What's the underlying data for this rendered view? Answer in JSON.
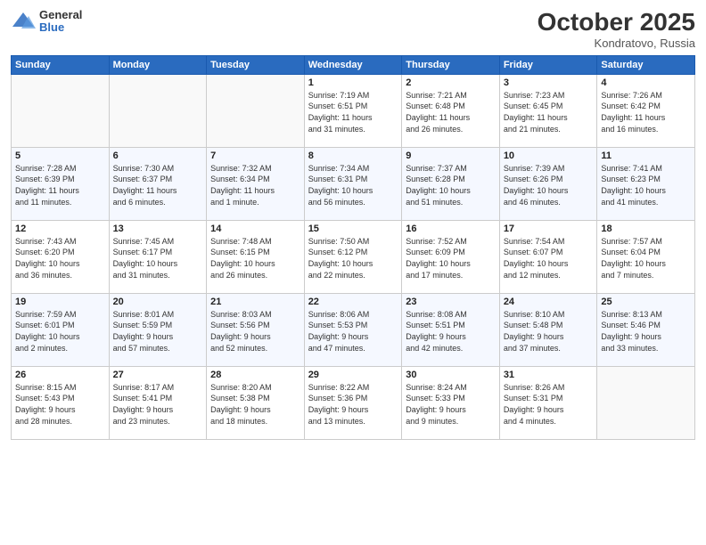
{
  "header": {
    "logo_general": "General",
    "logo_blue": "Blue",
    "month_title": "October 2025",
    "location": "Kondratovo, Russia"
  },
  "days_of_week": [
    "Sunday",
    "Monday",
    "Tuesday",
    "Wednesday",
    "Thursday",
    "Friday",
    "Saturday"
  ],
  "weeks": [
    [
      {
        "day": "",
        "info": ""
      },
      {
        "day": "",
        "info": ""
      },
      {
        "day": "",
        "info": ""
      },
      {
        "day": "1",
        "info": "Sunrise: 7:19 AM\nSunset: 6:51 PM\nDaylight: 11 hours\nand 31 minutes."
      },
      {
        "day": "2",
        "info": "Sunrise: 7:21 AM\nSunset: 6:48 PM\nDaylight: 11 hours\nand 26 minutes."
      },
      {
        "day": "3",
        "info": "Sunrise: 7:23 AM\nSunset: 6:45 PM\nDaylight: 11 hours\nand 21 minutes."
      },
      {
        "day": "4",
        "info": "Sunrise: 7:26 AM\nSunset: 6:42 PM\nDaylight: 11 hours\nand 16 minutes."
      }
    ],
    [
      {
        "day": "5",
        "info": "Sunrise: 7:28 AM\nSunset: 6:39 PM\nDaylight: 11 hours\nand 11 minutes."
      },
      {
        "day": "6",
        "info": "Sunrise: 7:30 AM\nSunset: 6:37 PM\nDaylight: 11 hours\nand 6 minutes."
      },
      {
        "day": "7",
        "info": "Sunrise: 7:32 AM\nSunset: 6:34 PM\nDaylight: 11 hours\nand 1 minute."
      },
      {
        "day": "8",
        "info": "Sunrise: 7:34 AM\nSunset: 6:31 PM\nDaylight: 10 hours\nand 56 minutes."
      },
      {
        "day": "9",
        "info": "Sunrise: 7:37 AM\nSunset: 6:28 PM\nDaylight: 10 hours\nand 51 minutes."
      },
      {
        "day": "10",
        "info": "Sunrise: 7:39 AM\nSunset: 6:26 PM\nDaylight: 10 hours\nand 46 minutes."
      },
      {
        "day": "11",
        "info": "Sunrise: 7:41 AM\nSunset: 6:23 PM\nDaylight: 10 hours\nand 41 minutes."
      }
    ],
    [
      {
        "day": "12",
        "info": "Sunrise: 7:43 AM\nSunset: 6:20 PM\nDaylight: 10 hours\nand 36 minutes."
      },
      {
        "day": "13",
        "info": "Sunrise: 7:45 AM\nSunset: 6:17 PM\nDaylight: 10 hours\nand 31 minutes."
      },
      {
        "day": "14",
        "info": "Sunrise: 7:48 AM\nSunset: 6:15 PM\nDaylight: 10 hours\nand 26 minutes."
      },
      {
        "day": "15",
        "info": "Sunrise: 7:50 AM\nSunset: 6:12 PM\nDaylight: 10 hours\nand 22 minutes."
      },
      {
        "day": "16",
        "info": "Sunrise: 7:52 AM\nSunset: 6:09 PM\nDaylight: 10 hours\nand 17 minutes."
      },
      {
        "day": "17",
        "info": "Sunrise: 7:54 AM\nSunset: 6:07 PM\nDaylight: 10 hours\nand 12 minutes."
      },
      {
        "day": "18",
        "info": "Sunrise: 7:57 AM\nSunset: 6:04 PM\nDaylight: 10 hours\nand 7 minutes."
      }
    ],
    [
      {
        "day": "19",
        "info": "Sunrise: 7:59 AM\nSunset: 6:01 PM\nDaylight: 10 hours\nand 2 minutes."
      },
      {
        "day": "20",
        "info": "Sunrise: 8:01 AM\nSunset: 5:59 PM\nDaylight: 9 hours\nand 57 minutes."
      },
      {
        "day": "21",
        "info": "Sunrise: 8:03 AM\nSunset: 5:56 PM\nDaylight: 9 hours\nand 52 minutes."
      },
      {
        "day": "22",
        "info": "Sunrise: 8:06 AM\nSunset: 5:53 PM\nDaylight: 9 hours\nand 47 minutes."
      },
      {
        "day": "23",
        "info": "Sunrise: 8:08 AM\nSunset: 5:51 PM\nDaylight: 9 hours\nand 42 minutes."
      },
      {
        "day": "24",
        "info": "Sunrise: 8:10 AM\nSunset: 5:48 PM\nDaylight: 9 hours\nand 37 minutes."
      },
      {
        "day": "25",
        "info": "Sunrise: 8:13 AM\nSunset: 5:46 PM\nDaylight: 9 hours\nand 33 minutes."
      }
    ],
    [
      {
        "day": "26",
        "info": "Sunrise: 8:15 AM\nSunset: 5:43 PM\nDaylight: 9 hours\nand 28 minutes."
      },
      {
        "day": "27",
        "info": "Sunrise: 8:17 AM\nSunset: 5:41 PM\nDaylight: 9 hours\nand 23 minutes."
      },
      {
        "day": "28",
        "info": "Sunrise: 8:20 AM\nSunset: 5:38 PM\nDaylight: 9 hours\nand 18 minutes."
      },
      {
        "day": "29",
        "info": "Sunrise: 8:22 AM\nSunset: 5:36 PM\nDaylight: 9 hours\nand 13 minutes."
      },
      {
        "day": "30",
        "info": "Sunrise: 8:24 AM\nSunset: 5:33 PM\nDaylight: 9 hours\nand 9 minutes."
      },
      {
        "day": "31",
        "info": "Sunrise: 8:26 AM\nSunset: 5:31 PM\nDaylight: 9 hours\nand 4 minutes."
      },
      {
        "day": "",
        "info": ""
      }
    ]
  ]
}
